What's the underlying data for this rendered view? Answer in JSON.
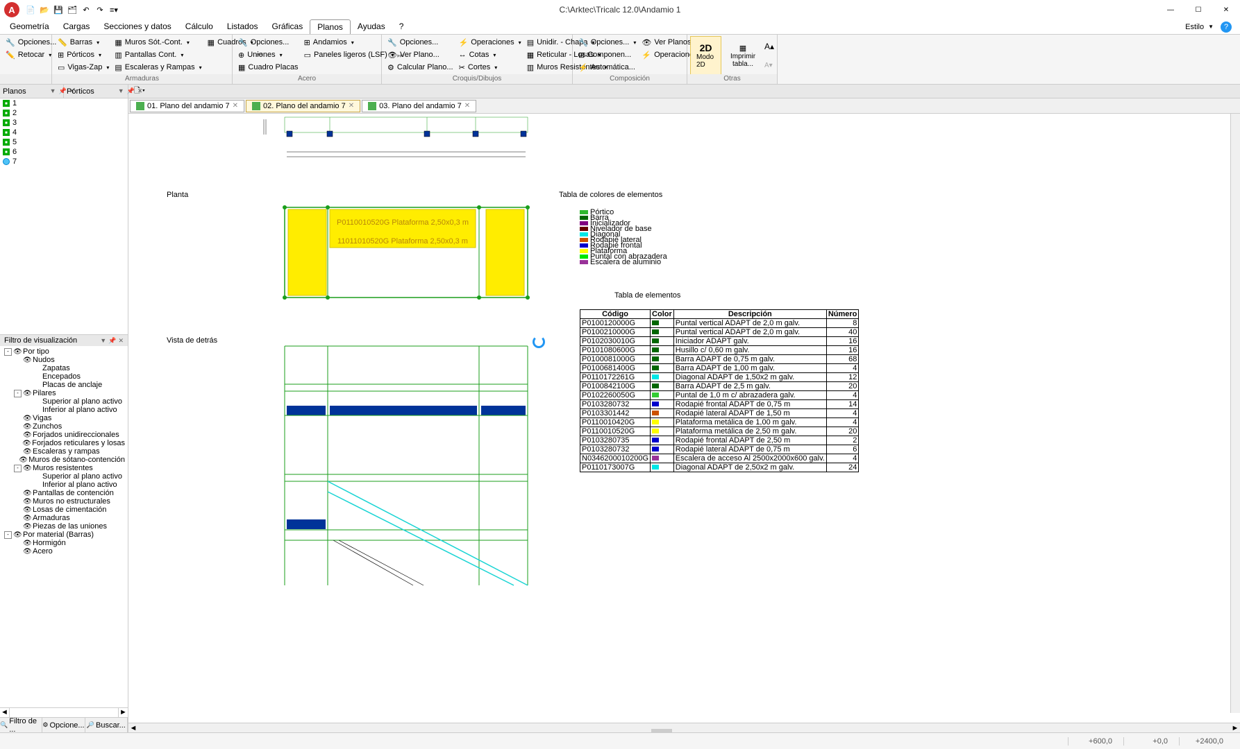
{
  "title": "C:\\Arktec\\Tricalc 12.0\\Andamio 1",
  "app_letter": "A",
  "menus": [
    "Geometría",
    "Cargas",
    "Secciones y datos",
    "Cálculo",
    "Listados",
    "Gráficas",
    "Planos",
    "Ayudas",
    "?"
  ],
  "active_menu": 6,
  "estilo": "Estilo",
  "ribbon": {
    "g1": {
      "opciones": "Opciones...",
      "retocar": "Retocar",
      "label": ""
    },
    "g2": {
      "barras": "Barras",
      "porticos": "Pórticos",
      "vigas": "Vigas-Zap",
      "muros": "Muros Sót.-Cont.",
      "pant": "Pantallas Cont.",
      "esc": "Escaleras y Rampas",
      "cuadros": "Cuadros",
      "label": "Armaduras"
    },
    "g3": {
      "opciones": "Opciones...",
      "uniones": "Uniones",
      "cuadro": "Cuadro Placas",
      "andamios": "Andamios",
      "paneles": "Paneles ligeros (LSF)",
      "label": "Acero"
    },
    "g4": {
      "opciones": "Opciones...",
      "ver": "Ver Plano...",
      "calc": "Calcular Plano...",
      "oper": "Operaciones",
      "cotas": "Cotas",
      "cortes": "Cortes",
      "unidir": "Unidir. - Chapa",
      "retic": "Reticular - Losas",
      "muros": "Muros Resistentes",
      "label": "Croquis/Dibujos"
    },
    "g5": {
      "opciones": "Opciones...",
      "compon": "Componen...",
      "auto": "Automática...",
      "ver": "Ver Planos...",
      "oper": "Operaciones",
      "label": "Composición"
    },
    "g6": {
      "modo": "Modo 2D",
      "imprimir": "Imprimir tabla...",
      "label": "Otras"
    }
  },
  "dock": {
    "planos": "Planos",
    "porticos": "Pórticos"
  },
  "planos_list": [
    "1",
    "2",
    "3",
    "4",
    "5",
    "6",
    "7"
  ],
  "filter_header": "Filtro de visualización",
  "filter_tabs": [
    "Filtro de ...",
    "Opcione...",
    "Buscar..."
  ],
  "tree": [
    {
      "l": 0,
      "exp": "-",
      "eye": true,
      "t": "Por tipo"
    },
    {
      "l": 1,
      "exp": "",
      "eye": true,
      "t": "Nudos"
    },
    {
      "l": 2,
      "exp": "",
      "eye": false,
      "t": "Zapatas"
    },
    {
      "l": 2,
      "exp": "",
      "eye": false,
      "t": "Encepados"
    },
    {
      "l": 2,
      "exp": "",
      "eye": false,
      "t": "Placas de anclaje"
    },
    {
      "l": 1,
      "exp": "-",
      "eye": true,
      "t": "Pilares"
    },
    {
      "l": 2,
      "exp": "",
      "eye": false,
      "t": "Superior al plano activo"
    },
    {
      "l": 2,
      "exp": "",
      "eye": false,
      "t": "Inferior al plano activo"
    },
    {
      "l": 1,
      "exp": "",
      "eye": true,
      "t": "Vigas"
    },
    {
      "l": 1,
      "exp": "",
      "eye": true,
      "t": "Zunchos"
    },
    {
      "l": 1,
      "exp": "",
      "eye": true,
      "t": "Forjados unidireccionales"
    },
    {
      "l": 1,
      "exp": "",
      "eye": true,
      "t": "Forjados reticulares y losas"
    },
    {
      "l": 1,
      "exp": "",
      "eye": true,
      "t": "Escaleras y rampas"
    },
    {
      "l": 1,
      "exp": "",
      "eye": true,
      "t": "Muros de sótano-contención"
    },
    {
      "l": 1,
      "exp": "-",
      "eye": true,
      "t": "Muros resistentes"
    },
    {
      "l": 2,
      "exp": "",
      "eye": false,
      "t": "Superior al plano activo"
    },
    {
      "l": 2,
      "exp": "",
      "eye": false,
      "t": "Inferior al plano activo"
    },
    {
      "l": 1,
      "exp": "",
      "eye": true,
      "t": "Pantallas de contención"
    },
    {
      "l": 1,
      "exp": "",
      "eye": true,
      "t": "Muros no estructurales"
    },
    {
      "l": 1,
      "exp": "",
      "eye": true,
      "t": "Losas de cimentación"
    },
    {
      "l": 1,
      "exp": "",
      "eye": true,
      "t": "Armaduras"
    },
    {
      "l": 1,
      "exp": "",
      "eye": true,
      "t": "Piezas de las uniones"
    },
    {
      "l": 0,
      "exp": "-",
      "eye": true,
      "t": "Por material (Barras)"
    },
    {
      "l": 1,
      "exp": "",
      "eye": true,
      "t": "Hormigón"
    },
    {
      "l": 1,
      "exp": "",
      "eye": true,
      "t": "Acero"
    }
  ],
  "doc_tabs": [
    {
      "label": "01. Plano del andamio 7",
      "active": false
    },
    {
      "label": "02. Plano del andamio 7",
      "active": true
    },
    {
      "label": "03. Plano del andamio 7",
      "active": false
    }
  ],
  "labels": {
    "planta": "Planta",
    "vista": "Vista de detrás",
    "colores": "Tabla de colores de elementos",
    "elementos": "Tabla de elementos"
  },
  "legend": [
    {
      "c": "#2eb82e",
      "t": "Pórtico"
    },
    {
      "c": "#006600",
      "t": "Barra"
    },
    {
      "c": "#800080",
      "t": "Inicializador"
    },
    {
      "c": "#660000",
      "t": "Nivelador de base"
    },
    {
      "c": "#00e6e6",
      "t": "Diagonal"
    },
    {
      "c": "#cc5200",
      "t": "Rodapié lateral"
    },
    {
      "c": "#0000cc",
      "t": "Rodapié frontal"
    },
    {
      "c": "#ffff00",
      "t": "Plataforma"
    },
    {
      "c": "#00e600",
      "t": "Puntal con abrazadera"
    },
    {
      "c": "#993399",
      "t": "Escalera de aluminio"
    }
  ],
  "table_headers": [
    "Código",
    "Color",
    "Descripción",
    "Número"
  ],
  "table_rows": [
    {
      "code": "P0100120000G",
      "c": "#006600",
      "desc": "Puntal vertical ADAPT de 2,0 m galv.",
      "n": "8"
    },
    {
      "code": "P0100210000G",
      "c": "#006600",
      "desc": "Puntal vertical ADAPT de 2,0 m galv.",
      "n": "40"
    },
    {
      "code": "P0102030010G",
      "c": "#006600",
      "desc": "Iniciador ADAPT galv.",
      "n": "16"
    },
    {
      "code": "P0101080600G",
      "c": "#006600",
      "desc": "Husillo c/ 0,60 m galv.",
      "n": "16"
    },
    {
      "code": "P0100081000G",
      "c": "#006600",
      "desc": "Barra ADAPT de 0,75 m galv.",
      "n": "68"
    },
    {
      "code": "P0100681400G",
      "c": "#006600",
      "desc": "Barra ADAPT de 1,00 m galv.",
      "n": "4"
    },
    {
      "code": "P0110172261G",
      "c": "#00e6e6",
      "desc": "Diagonal ADAPT de 1,50x2 m galv.",
      "n": "12"
    },
    {
      "code": "P0100842100G",
      "c": "#006600",
      "desc": "Barra ADAPT de 2,5 m galv.",
      "n": "20"
    },
    {
      "code": "P0102260050G",
      "c": "#33cc33",
      "desc": "Puntal de 1,0 m c/ abrazadera galv.",
      "n": "4"
    },
    {
      "code": "P0103280732",
      "c": "#0000cc",
      "desc": "Rodapié frontal ADAPT de 0,75 m",
      "n": "14"
    },
    {
      "code": "P0103301442",
      "c": "#cc5200",
      "desc": "Rodapié lateral ADAPT de 1,50 m",
      "n": "4"
    },
    {
      "code": "P0110010420G",
      "c": "#ffff00",
      "desc": "Plataforma metálica de 1,00 m galv.",
      "n": "4"
    },
    {
      "code": "P0110010520G",
      "c": "#ffff00",
      "desc": "Plataforma metálica de 2,50 m galv.",
      "n": "20"
    },
    {
      "code": "P0103280735",
      "c": "#0000cc",
      "desc": "Rodapié frontal ADAPT de 2,50 m",
      "n": "2"
    },
    {
      "code": "P0103280732",
      "c": "#0000cc",
      "desc": "Rodapié lateral ADAPT de 0,75 m",
      "n": "6"
    },
    {
      "code": "N0346200010200G",
      "c": "#993399",
      "desc": "Escalera de acceso Al 2500x2000x600 galv.",
      "n": "4"
    },
    {
      "code": "P0110173007G",
      "c": "#00e6e6",
      "desc": "Diagonal ADAPT de 2,50x2 m galv.",
      "n": "24"
    }
  ],
  "status": {
    "x": "+600,0",
    "y": "+0,0",
    "z": "+2400,0"
  }
}
